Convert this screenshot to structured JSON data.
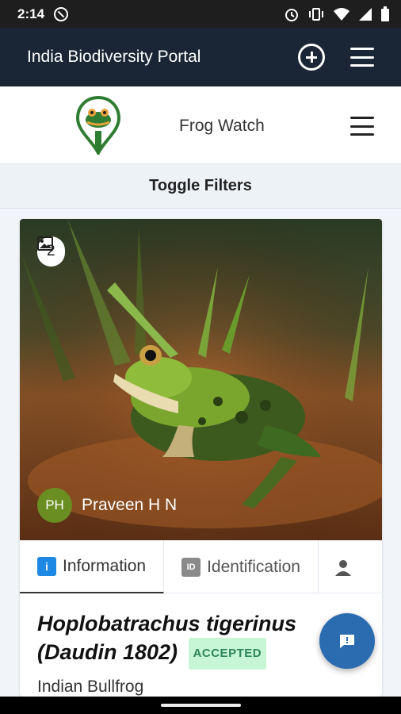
{
  "status_bar": {
    "time": "2:14"
  },
  "app_bar": {
    "title": "India Biodiversity Portal"
  },
  "site_header": {
    "title": "Frog Watch"
  },
  "filters": {
    "toggle_label": "Toggle Filters"
  },
  "observation": {
    "image_count": "2",
    "author_initials": "PH",
    "author_name": "Praveen H N",
    "tabs": [
      {
        "label": "Information",
        "icon": "info-icon"
      },
      {
        "label": "Identification",
        "icon": "id-icon"
      },
      {
        "label": "",
        "icon": "person-icon"
      }
    ],
    "scientific_name": "Hoplobatrachus tigerinus (Daudin 1802)",
    "status_badge": "ACCEPTED",
    "common_name": "Indian Bullfrog"
  },
  "colors": {
    "app_bar": "#1a2535",
    "accent": "#2b6cb0",
    "badge_text": "#2f855a",
    "badge_bg": "#c6f6d5"
  }
}
